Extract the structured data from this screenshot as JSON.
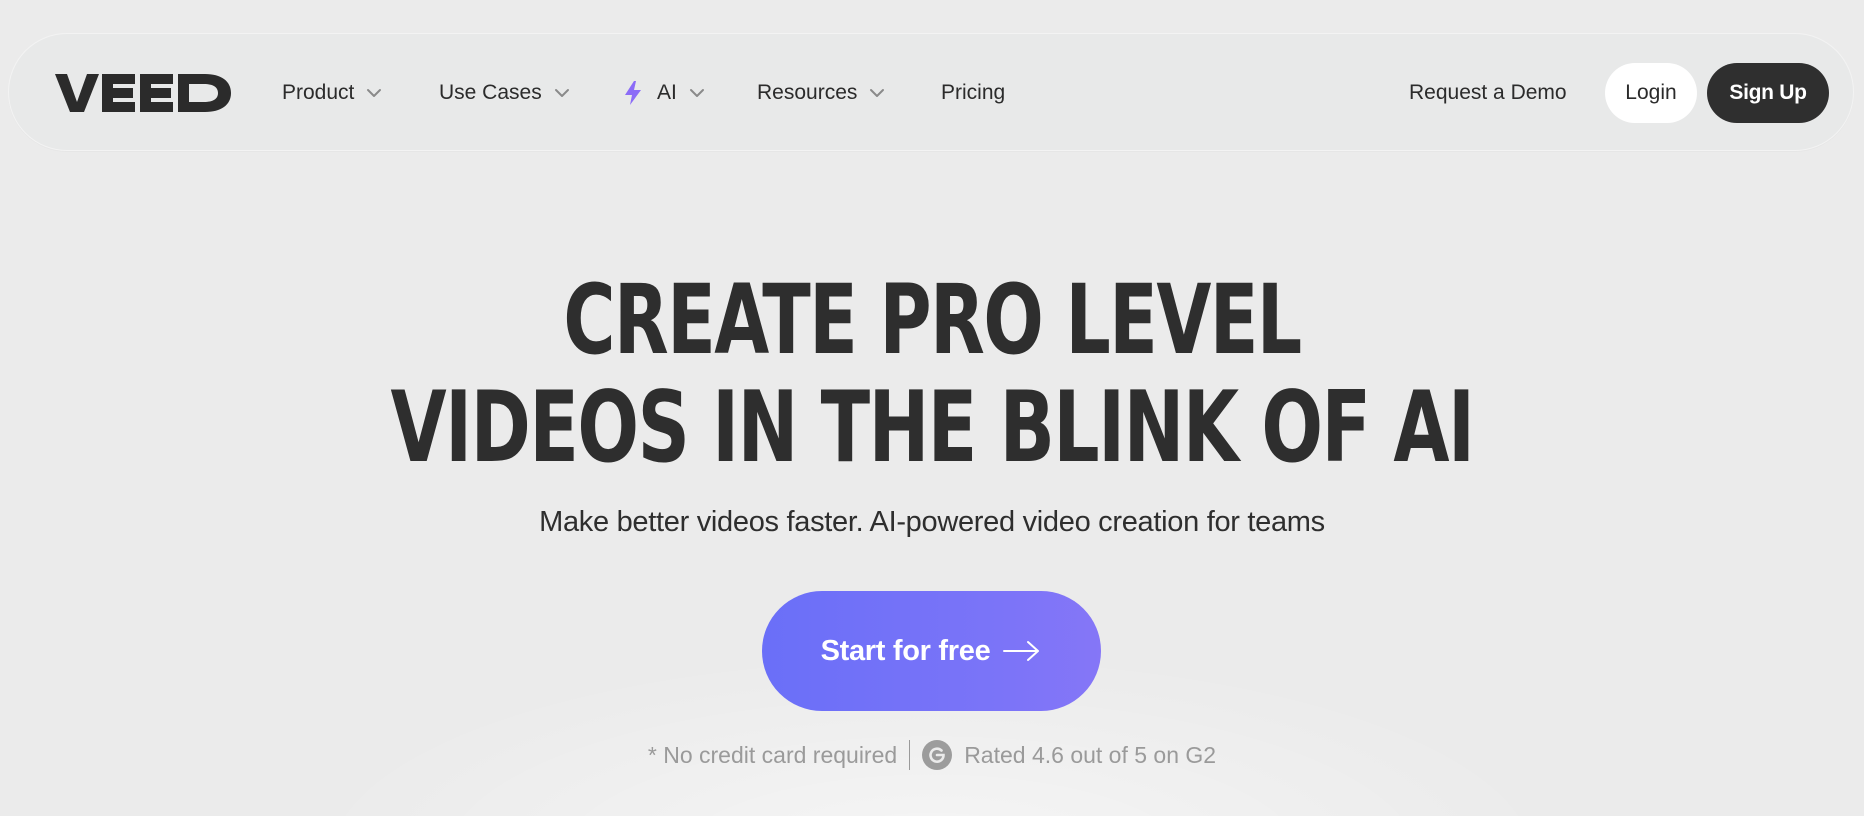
{
  "nav": {
    "logo_text": "VEED",
    "items": [
      {
        "label": "Product",
        "has_dropdown": true
      },
      {
        "label": "Use Cases",
        "has_dropdown": true
      },
      {
        "label": "AI",
        "has_dropdown": true,
        "icon": "lightning-bolt-icon"
      },
      {
        "label": "Resources",
        "has_dropdown": true
      },
      {
        "label": "Pricing",
        "has_dropdown": false
      }
    ],
    "request_demo": "Request a Demo",
    "login": "Login",
    "signup": "Sign Up"
  },
  "hero": {
    "title_line1": "CREATE PRO LEVEL",
    "title_line2": "VIDEOS IN THE BLINK OF AI",
    "subtitle": "Make better videos faster. AI-powered video creation for teams",
    "cta_label": "Start for free",
    "footnote_left": "* No credit card required",
    "footnote_right": "Rated 4.6 out of 5 on G2"
  },
  "colors": {
    "background": "#ebebeb",
    "text_dark": "#2e2e2e",
    "cta_gradient_start": "#6a6ff8",
    "cta_gradient_end": "#8576f7",
    "signup_bg": "#2f2f2f",
    "ai_bolt": "#8b6cf7",
    "muted": "#9a9a9a"
  }
}
